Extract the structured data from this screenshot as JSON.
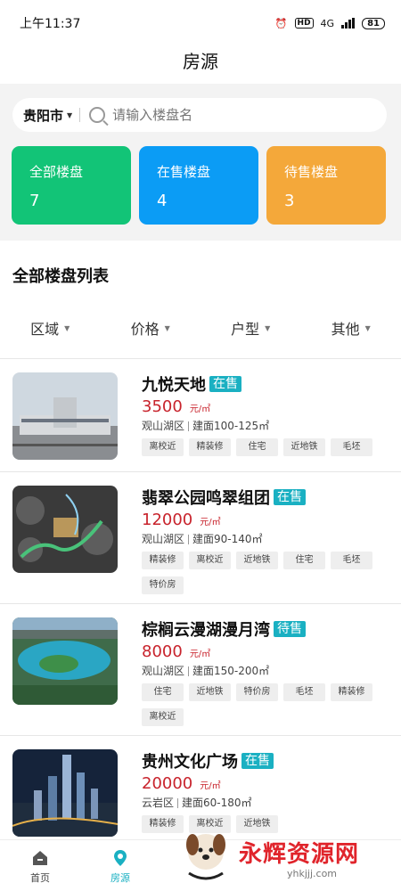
{
  "status_bar": {
    "time": "上午11:37",
    "hd": "HD",
    "network": "4G",
    "battery": "81"
  },
  "header": {
    "title": "房源"
  },
  "search": {
    "city": "贵阳市",
    "placeholder": "请输入楼盘名"
  },
  "stats": [
    {
      "label": "全部楼盘",
      "count": "7",
      "color": "#12c477"
    },
    {
      "label": "在售楼盘",
      "count": "4",
      "color": "#0b9cf5"
    },
    {
      "label": "待售楼盘",
      "count": "3",
      "color": "#f4a83a"
    }
  ],
  "section_title": "全部楼盘列表",
  "filters": [
    "区域",
    "价格",
    "户型",
    "其他"
  ],
  "listings": [
    {
      "name": "九悦天地",
      "status": "在售",
      "price": "3500",
      "unit": "元/㎡",
      "district": "观山湖区",
      "area": "建面100-125㎡",
      "tags": [
        "离校近",
        "精装修",
        "住宅",
        "近地铁",
        "毛坯"
      ]
    },
    {
      "name": "翡翠公园鸣翠组团",
      "status": "在售",
      "price": "12000",
      "unit": "元/㎡",
      "district": "观山湖区",
      "area": "建面90-140㎡",
      "tags": [
        "精装修",
        "离校近",
        "近地铁",
        "住宅",
        "毛坯",
        "特价房"
      ]
    },
    {
      "name": "棕榈云漫湖漫月湾",
      "status": "待售",
      "price": "8000",
      "unit": "元/㎡",
      "district": "观山湖区",
      "area": "建面150-200㎡",
      "tags": [
        "住宅",
        "近地铁",
        "特价房",
        "毛坯",
        "精装修",
        "离校近"
      ]
    },
    {
      "name": "贵州文化广场",
      "status": "在售",
      "price": "20000",
      "unit": "元/㎡",
      "district": "云岩区",
      "area": "建面60-180㎡",
      "tags": [
        "精装修",
        "离校近",
        "近地铁"
      ]
    }
  ],
  "tabbar": [
    {
      "label": "首页",
      "icon": "home-icon"
    },
    {
      "label": "房源",
      "icon": "location-icon"
    }
  ],
  "watermark": {
    "text": "永辉资源网",
    "url": "yhkjjj.com"
  }
}
